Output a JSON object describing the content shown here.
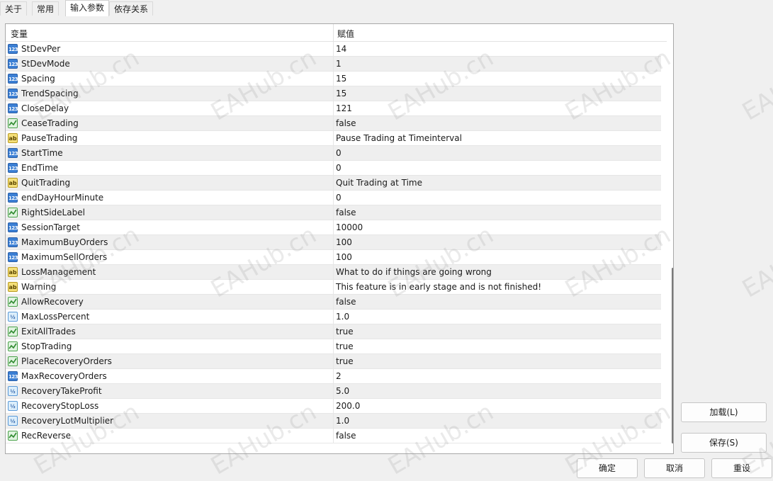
{
  "tabs": [
    {
      "label": "关于"
    },
    {
      "label": "常用"
    },
    {
      "label": "输入参数",
      "active": true
    },
    {
      "label": "依存关系"
    }
  ],
  "table": {
    "columns": [
      "变量",
      "赋值"
    ],
    "rows": [
      {
        "name": "StDevPer",
        "value": "14",
        "type": "int-icon"
      },
      {
        "name": "StDevMode",
        "value": "1",
        "type": "int-icon"
      },
      {
        "name": "Spacing",
        "value": "15",
        "type": "int-icon"
      },
      {
        "name": "TrendSpacing",
        "value": "15",
        "type": "int-icon"
      },
      {
        "name": "CloseDelay",
        "value": "121",
        "type": "int-icon"
      },
      {
        "name": "CeaseTrading",
        "value": "false",
        "type": "bool-icon"
      },
      {
        "name": "PauseTrading",
        "value": "Pause Trading at Timeinterval",
        "type": "string-icon"
      },
      {
        "name": "StartTime",
        "value": "0",
        "type": "int-icon"
      },
      {
        "name": "EndTime",
        "value": "0",
        "type": "int-icon"
      },
      {
        "name": "QuitTrading",
        "value": "Quit Trading at Time",
        "type": "string-icon"
      },
      {
        "name": "endDayHourMinute",
        "value": "0",
        "type": "int-icon"
      },
      {
        "name": "RightSideLabel",
        "value": "false",
        "type": "bool-icon"
      },
      {
        "name": "SessionTarget",
        "value": "10000",
        "type": "int-icon"
      },
      {
        "name": "MaximumBuyOrders",
        "value": "100",
        "type": "int-icon"
      },
      {
        "name": "MaximumSellOrders",
        "value": "100",
        "type": "int-icon"
      },
      {
        "name": "LossManagement",
        "value": "What to do if things are going wrong",
        "type": "string-icon"
      },
      {
        "name": "Warning",
        "value": "This feature is in early stage and is not finished!",
        "type": "string-icon"
      },
      {
        "name": "AllowRecovery",
        "value": "false",
        "type": "bool-icon"
      },
      {
        "name": "MaxLossPercent",
        "value": "1.0",
        "type": "double-icon"
      },
      {
        "name": "ExitAllTrades",
        "value": "true",
        "type": "bool-icon"
      },
      {
        "name": "StopTrading",
        "value": "true",
        "type": "bool-icon"
      },
      {
        "name": "PlaceRecoveryOrders",
        "value": "true",
        "type": "bool-icon"
      },
      {
        "name": "MaxRecoveryOrders",
        "value": "2",
        "type": "int-icon"
      },
      {
        "name": "RecoveryTakeProfit",
        "value": "5.0",
        "type": "double-icon"
      },
      {
        "name": "RecoveryStopLoss",
        "value": "200.0",
        "type": "double-icon"
      },
      {
        "name": "RecoveryLotMultiplier",
        "value": "1.0",
        "type": "double-icon"
      },
      {
        "name": "RecReverse",
        "value": "false",
        "type": "bool-icon"
      }
    ]
  },
  "icons": {
    "int": "123",
    "string": "ab",
    "double": "½"
  },
  "buttons": {
    "load": "加载(L)",
    "save": "保存(S)",
    "ok": "确定",
    "cancel": "取消",
    "reset": "重设"
  },
  "watermark": "EAHub.cn"
}
